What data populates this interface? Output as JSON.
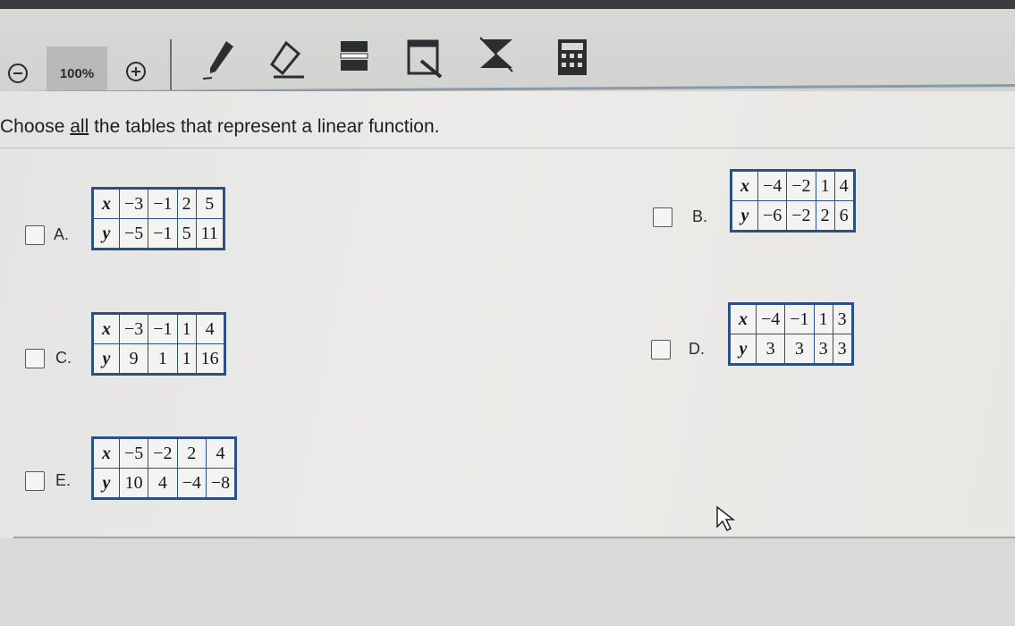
{
  "toolbar": {
    "zoom_level": "100%",
    "icons": [
      "zoom-out-icon",
      "zoom-in-icon",
      "pen-icon",
      "eraser-icon",
      "highlighter-icon",
      "note-icon",
      "clear-icon",
      "calculator-icon"
    ]
  },
  "question": {
    "prefix": "Choose ",
    "emphasis": "all",
    "suffix": " the tables that represent a linear function."
  },
  "options": [
    {
      "letter": "A.",
      "x_label": "x",
      "y_label": "y",
      "x": [
        "−3",
        "−1",
        "2",
        "5"
      ],
      "y": [
        "−5",
        "−1",
        "5",
        "11"
      ]
    },
    {
      "letter": "B.",
      "x_label": "x",
      "y_label": "y",
      "x": [
        "−4",
        "−2",
        "1",
        "4"
      ],
      "y": [
        "−6",
        "−2",
        "2",
        "6"
      ]
    },
    {
      "letter": "C.",
      "x_label": "x",
      "y_label": "y",
      "x": [
        "−3",
        "−1",
        "1",
        "4"
      ],
      "y": [
        "9",
        "1",
        "1",
        "16"
      ]
    },
    {
      "letter": "D.",
      "x_label": "x",
      "y_label": "y",
      "x": [
        "−4",
        "−1",
        "1",
        "3"
      ],
      "y": [
        "3",
        "3",
        "3",
        "3"
      ]
    },
    {
      "letter": "E.",
      "x_label": "x",
      "y_label": "y",
      "x": [
        "−5",
        "−2",
        "2",
        "4"
      ],
      "y": [
        "10",
        "4",
        "−4",
        "−8"
      ]
    }
  ],
  "colors": {
    "table_border": "#2b4f86",
    "toolbar_bg": "#d8d9d7",
    "zoom_bg": "#b9bab8"
  }
}
